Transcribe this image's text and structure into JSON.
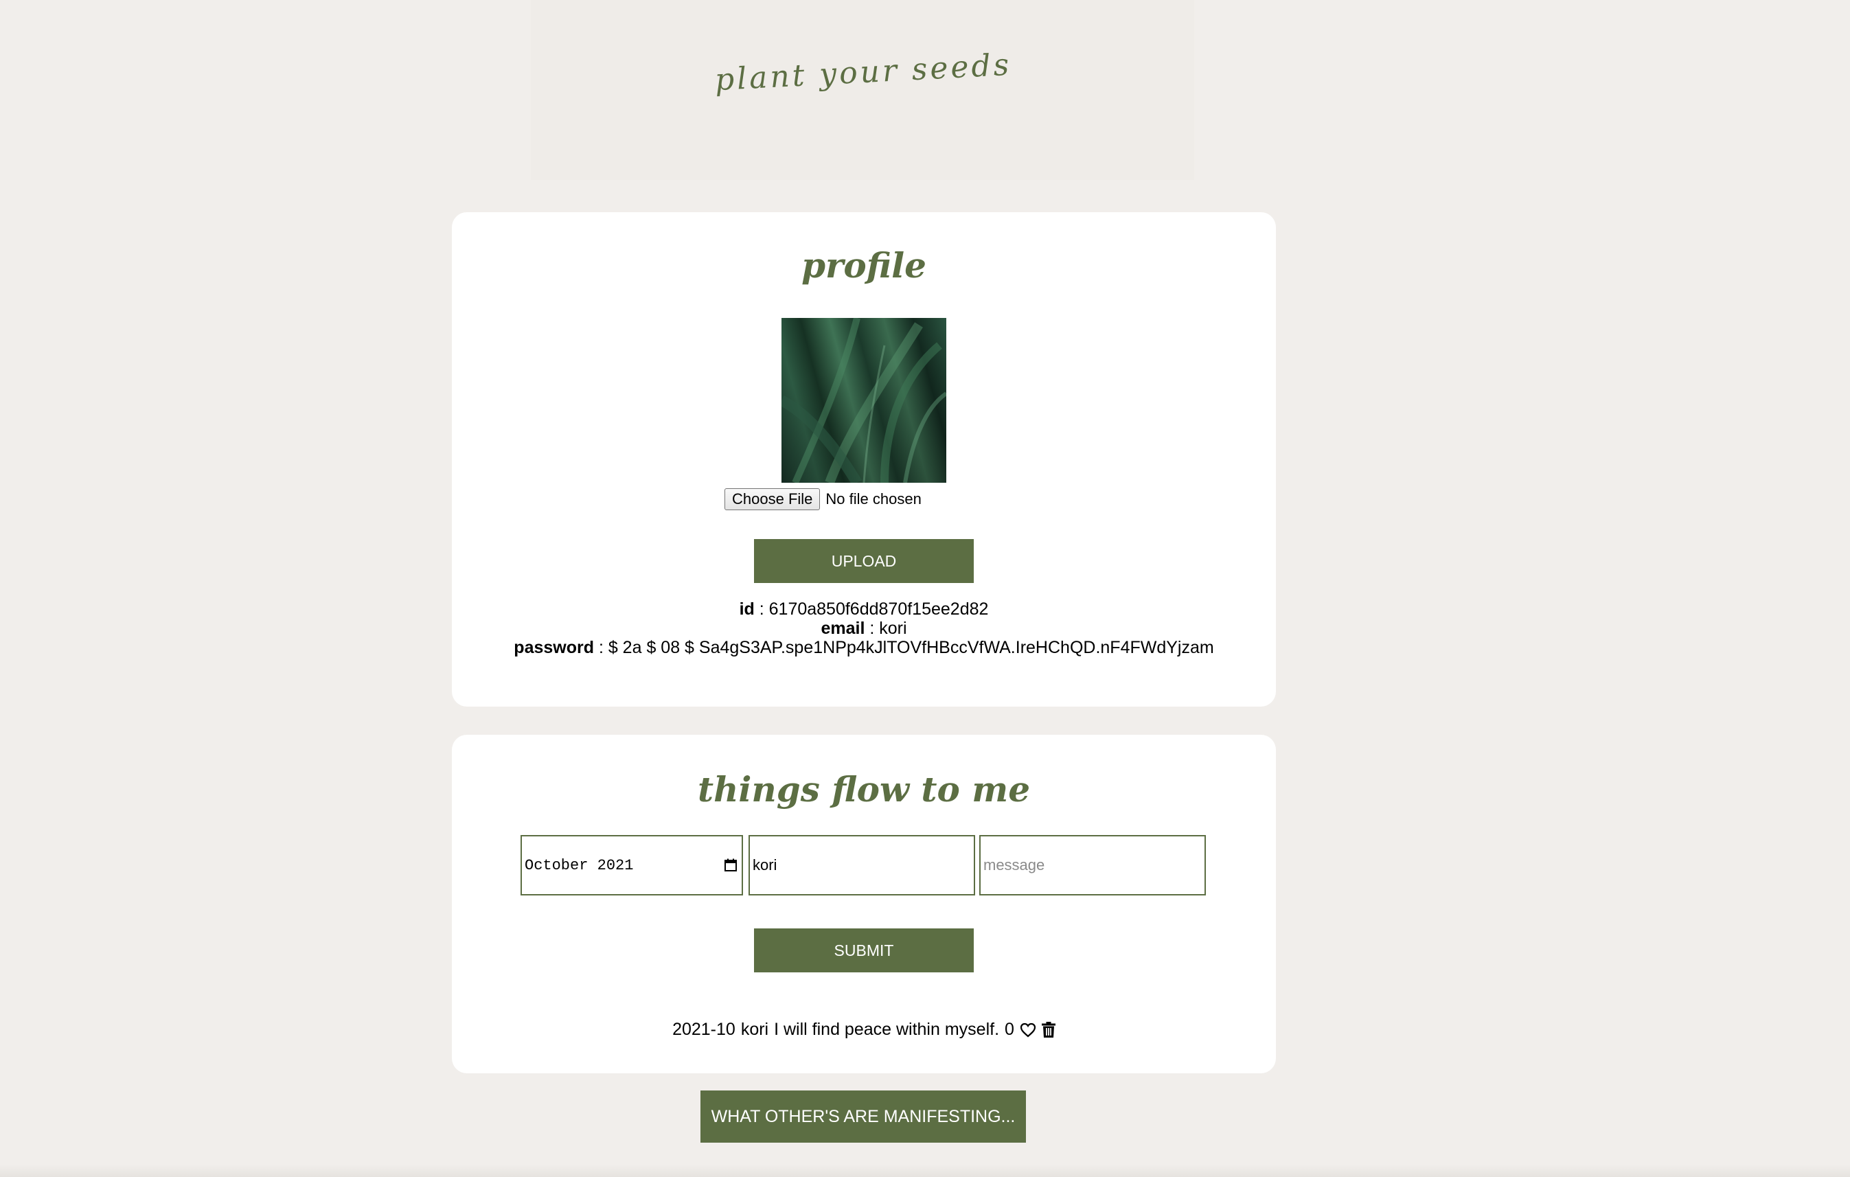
{
  "site": {
    "title": "plant your seeds"
  },
  "profile": {
    "title": "profile",
    "image_alt": "dark green leaves photo",
    "file_input": {
      "button_label": "Choose File",
      "status": "No file chosen"
    },
    "upload_label": "UPLOAD",
    "id_label": "id",
    "id_value": " : 6170a850f6dd870f15ee2d82",
    "email_label": "email",
    "email_value": " : kori",
    "password_label": "password",
    "password_value": " : $ 2a $ 08 $ Sa4gS3AP.spe1NPp4kJlTOVfHBccVfWA.IreHChQD.nF4FWdYjzam"
  },
  "flow": {
    "title": "things flow to me",
    "date_value": "October 2021",
    "name_value": "kori",
    "message_placeholder": "message",
    "submit_label": "SUBMIT",
    "entry": {
      "date": "2021-10",
      "name": "kori",
      "message": "I will find peace within myself.",
      "likes": "0"
    }
  },
  "manifest_button_label": "WHAT OTHER'S ARE MANIFESTING...",
  "colors": {
    "accent": "#5c6e43",
    "background": "#f1eeeb",
    "card": "#ffffff"
  },
  "icons": [
    "calendar-icon",
    "heart-icon",
    "trash-icon"
  ]
}
